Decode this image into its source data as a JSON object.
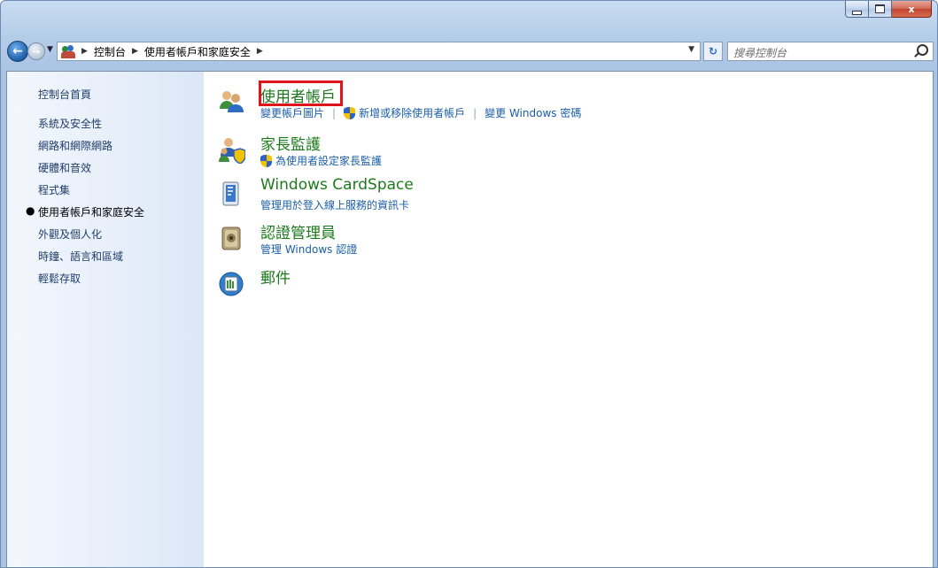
{
  "window": {
    "controls": {
      "minimize": "",
      "maximize": "",
      "close": "x"
    }
  },
  "nav": {
    "breadcrumbs": [
      "控制台",
      "使用者帳戶和家庭安全"
    ],
    "search_placeholder": "搜尋控制台"
  },
  "sidebar": {
    "home": "控制台首頁",
    "items": [
      "系統及安全性",
      "網路和網際網路",
      "硬體和音效",
      "程式集",
      "使用者帳戶和家庭安全",
      "外觀及個人化",
      "時鐘、語言和區域",
      "輕鬆存取"
    ],
    "current_index": 4,
    "bullet": "●"
  },
  "categories": [
    {
      "title": "使用者帳戶",
      "icon": "user-accounts-icon",
      "links": [
        "變更帳戶圖片",
        "新增或移除使用者帳戶",
        "變更 Windows 密碼"
      ]
    },
    {
      "title": "家長監護",
      "icon": "parental-controls-icon",
      "links": [
        "為使用者設定家長監護"
      ]
    },
    {
      "title": "Windows CardSpace",
      "icon": "cardspace-icon",
      "links": [
        "管理用於登入線上服務的資訊卡"
      ]
    },
    {
      "title": "認證管理員",
      "icon": "credential-manager-icon",
      "links": [
        "管理 Windows 認證"
      ]
    },
    {
      "title": "郵件",
      "icon": "mail-icon",
      "links": []
    }
  ],
  "colors": {
    "category_title": "#1c7a1c",
    "link": "#1b5ea8",
    "highlight": "#e0141b"
  }
}
